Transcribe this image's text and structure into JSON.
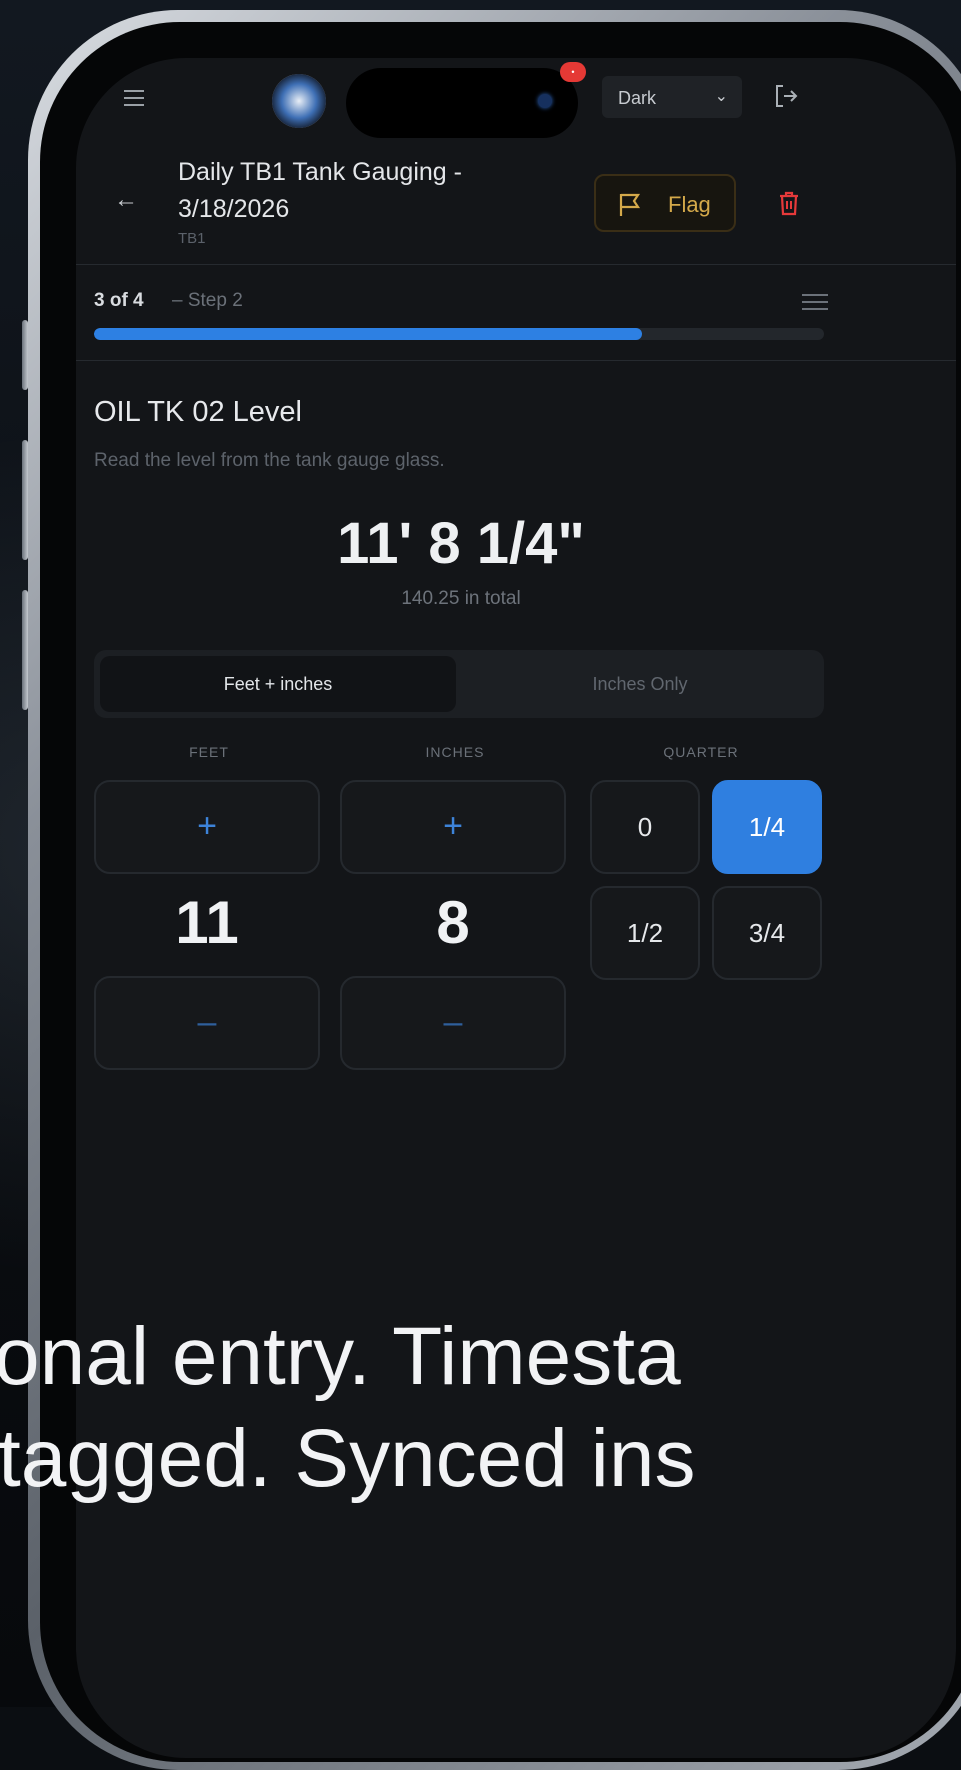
{
  "topbar": {
    "theme_select": "Dark",
    "notification_badge": "•"
  },
  "header": {
    "title": "Daily TB1 Tank Gauging - 3/18/2026",
    "subtitle": "TB1",
    "flag_label": "Flag"
  },
  "progress": {
    "step_count": "3 of 4",
    "step_label": "– Step 2",
    "fraction": 0.75
  },
  "field": {
    "title": "OIL TK 02 Level",
    "description": "Read the level from the tank gauge glass.",
    "display_value": "11' 8 1/4\"",
    "total_text": "140.25 in total"
  },
  "mode_toggle": {
    "options": [
      "Feet + inches",
      "Inches Only"
    ],
    "selected": "Feet + inches"
  },
  "entry": {
    "feet_label": "FEET",
    "inches_label": "INCHES",
    "quarter_label": "QUARTER",
    "plus": "+",
    "minus": "–",
    "feet_value": "11",
    "inches_value": "8",
    "quarters": [
      "0",
      "1/4",
      "1/2",
      "3/4"
    ],
    "selected_quarter": "1/4"
  },
  "caption": {
    "line1": "onal entry. Timesta",
    "line2": "tagged. Synced ins"
  },
  "colors": {
    "accent": "#2f7fe0",
    "flag": "#d4a94a",
    "danger": "#e5393a",
    "background": "#131518"
  },
  "icons": [
    "hamburger-icon",
    "app-logo",
    "chevron-down-icon",
    "logout-icon",
    "back-arrow-icon",
    "flag-icon",
    "trash-icon",
    "list-icon"
  ]
}
